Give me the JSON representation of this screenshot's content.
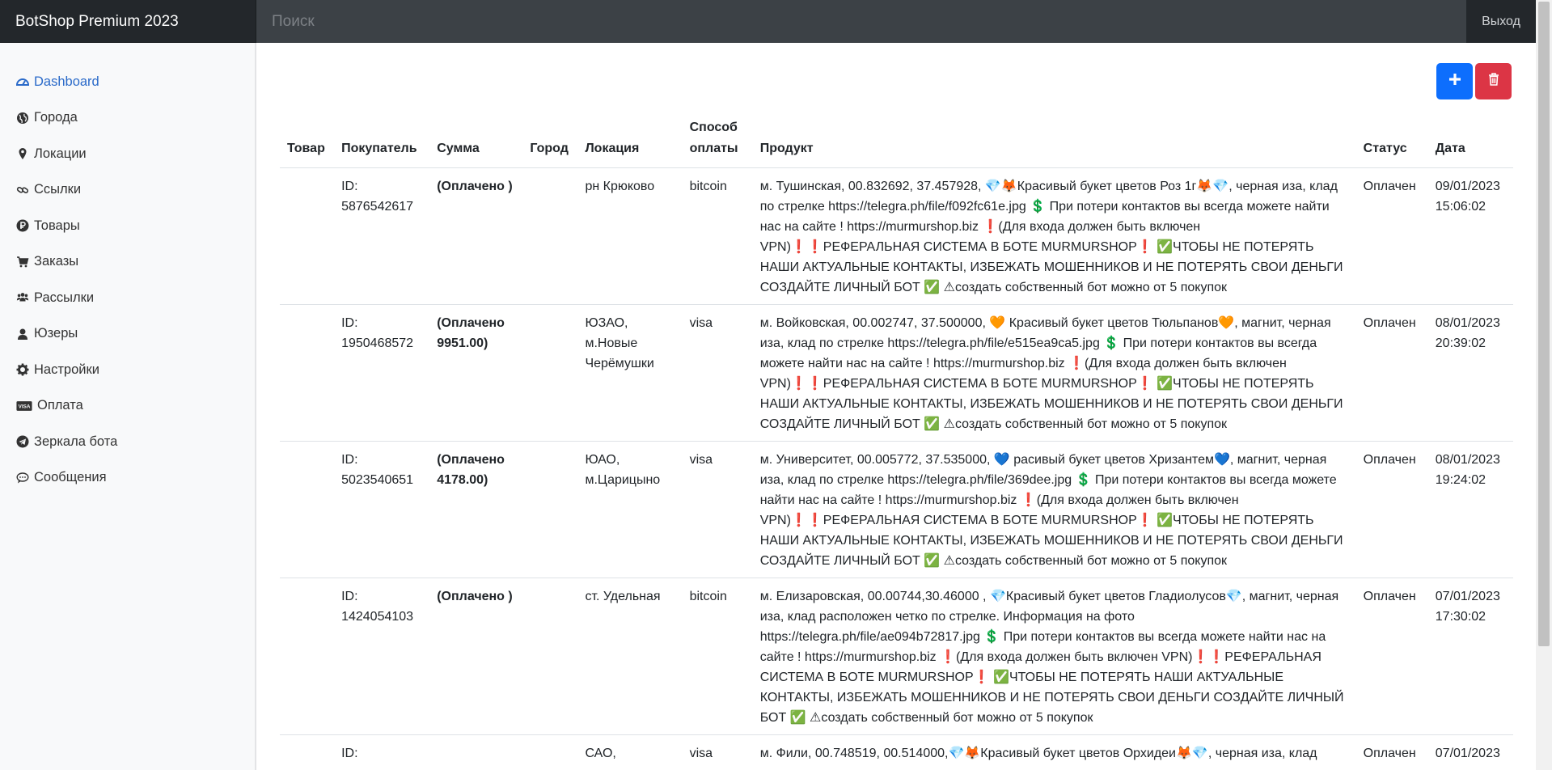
{
  "navbar": {
    "brand": "BotShop Premium 2023",
    "search_placeholder": "Поиск",
    "logout_label": "Выход"
  },
  "sidebar": {
    "items": [
      {
        "label": "Dashboard",
        "icon": "dashboard-icon",
        "active": true
      },
      {
        "label": "Города",
        "icon": "globe-icon"
      },
      {
        "label": "Локации",
        "icon": "map-marker-icon"
      },
      {
        "label": "Ссылки",
        "icon": "link-icon"
      },
      {
        "label": "Товары",
        "icon": "ruble-icon"
      },
      {
        "label": "Заказы",
        "icon": "cart-icon"
      },
      {
        "label": "Рассылки",
        "icon": "users-icon"
      },
      {
        "label": "Юзеры",
        "icon": "user-icon"
      },
      {
        "label": "Настройки",
        "icon": "gear-icon"
      },
      {
        "label": "Оплата",
        "icon": "visa-icon"
      },
      {
        "label": "Зеркала бота",
        "icon": "telegram-icon"
      },
      {
        "label": "Сообщения",
        "icon": "chat-icon"
      }
    ]
  },
  "actions": {
    "add_icon": "plus-icon",
    "delete_icon": "trash-icon",
    "colors": {
      "add": "#0d6efd",
      "delete": "#dc3545"
    }
  },
  "table": {
    "headers": [
      "Товар",
      "Покупатель",
      "Сумма",
      "Город",
      "Локация",
      "Способ оплаты",
      "Продукт",
      "Статус",
      "Дата"
    ],
    "rows": [
      {
        "item": "",
        "buyer": "ID: 5876542617",
        "amount": "(Оплачено )",
        "city": "",
        "location": "рн Крюково",
        "payment": "bitcoin",
        "product": "м. Тушинская, 00.832692, 37.457928, 💎🦊Красивый букет цветов Роз 1г🦊💎, черная иза, клад по стрелке https://telegra.ph/file/f092fc61e.jpg 💲 При потери контактов вы всегда можете найти нас на сайте ! https://murmurshop.biz ❗(Для входа должен быть включен VPN)❗❗РЕФЕРАЛЬНАЯ СИСТЕМА В БОТЕ MURMURSHOP❗ ✅ЧТОБЫ НЕ ПОТЕРЯТЬ НАШИ АКТУАЛЬНЫЕ КОНТАКТЫ, ИЗБЕЖАТЬ МОШЕННИКОВ И НЕ ПОТЕРЯТЬ СВОИ ДЕНЬГИ СОЗДАЙТЕ ЛИЧНЫЙ БОТ ✅ ⚠создать собственный бот можно от 5 покупок",
        "status": "Оплачен",
        "date": "09/01/2023 15:06:02"
      },
      {
        "item": "",
        "buyer": "ID: 1950468572",
        "amount": "(Оплачено 9951.00)",
        "city": "",
        "location": "ЮЗАО, м.Новые Черёмушки",
        "payment": "visa",
        "product": "м. Войковская, 00.002747, 37.500000, 🧡 Красивый букет цветов Тюльпанов🧡, магнит, черная иза, клад по стрелке https://telegra.ph/file/e515ea9ca5.jpg 💲 При потери контактов вы всегда можете найти нас на сайте ! https://murmurshop.biz ❗(Для входа должен быть включен VPN)❗❗РЕФЕРАЛЬНАЯ СИСТЕМА В БОТЕ MURMURSHOP❗ ✅ЧТОБЫ НЕ ПОТЕРЯТЬ НАШИ АКТУАЛЬНЫЕ КОНТАКТЫ, ИЗБЕЖАТЬ МОШЕННИКОВ И НЕ ПОТЕРЯТЬ СВОИ ДЕНЬГИ СОЗДАЙТЕ ЛИЧНЫЙ БОТ ✅ ⚠создать собственный бот можно от 5 покупок",
        "status": "Оплачен",
        "date": "08/01/2023 20:39:02"
      },
      {
        "item": "",
        "buyer": "ID: 5023540651",
        "amount": "(Оплачено 4178.00)",
        "city": "",
        "location": "ЮАО, м.Царицыно",
        "payment": "visa",
        "product": "м. Университет, 00.005772, 37.535000, 💙 расивый букет цветов Хризантем💙, магнит, черная иза, клад по стрелке https://telegra.ph/file/369dee.jpg 💲 При потери контактов вы всегда можете найти нас на сайте ! https://murmurshop.biz ❗(Для входа должен быть включен VPN)❗❗РЕФЕРАЛЬНАЯ СИСТЕМА В БОТЕ MURMURSHOP❗ ✅ЧТОБЫ НЕ ПОТЕРЯТЬ НАШИ АКТУАЛЬНЫЕ КОНТАКТЫ, ИЗБЕЖАТЬ МОШЕННИКОВ И НЕ ПОТЕРЯТЬ СВОИ ДЕНЬГИ СОЗДАЙТЕ ЛИЧНЫЙ БОТ ✅ ⚠создать собственный бот можно от 5 покупок",
        "status": "Оплачен",
        "date": "08/01/2023 19:24:02"
      },
      {
        "item": "",
        "buyer": "ID: 1424054103",
        "amount": "(Оплачено )",
        "city": "",
        "location": "ст. Удельная",
        "payment": "bitcoin",
        "product": "м. Елизаровская, 00.00744,30.46000 , 💎Красивый букет цветов Гладиолусов💎, магнит, черная иза, клад расположен четко по стрелке. Информация на фото https://telegra.ph/file/ae094b72817.jpg 💲 При потери контактов вы всегда можете найти нас на сайте ! https://murmurshop.biz ❗(Для входа должен быть включен VPN)❗❗РЕФЕРАЛЬНАЯ СИСТЕМА В БОТЕ MURMURSHOP❗ ✅ЧТОБЫ НЕ ПОТЕРЯТЬ НАШИ АКТУАЛЬНЫЕ КОНТАКТЫ, ИЗБЕЖАТЬ МОШЕННИКОВ И НЕ ПОТЕРЯТЬ СВОИ ДЕНЬГИ СОЗДАЙТЕ ЛИЧНЫЙ БОТ ✅ ⚠создать собственный бот можно от 5 покупок",
        "status": "Оплачен",
        "date": "07/01/2023 17:30:02"
      },
      {
        "item": "",
        "buyer": "ID:",
        "amount": "",
        "city": "",
        "location": "САО,",
        "payment": "visa",
        "product": "м. Фили, 00.748519, 00.514000,💎🦊Красивый букет цветов Орхидеи🦊💎, черная иза, клад",
        "status": "Оплачен",
        "date": "07/01/2023"
      }
    ]
  }
}
